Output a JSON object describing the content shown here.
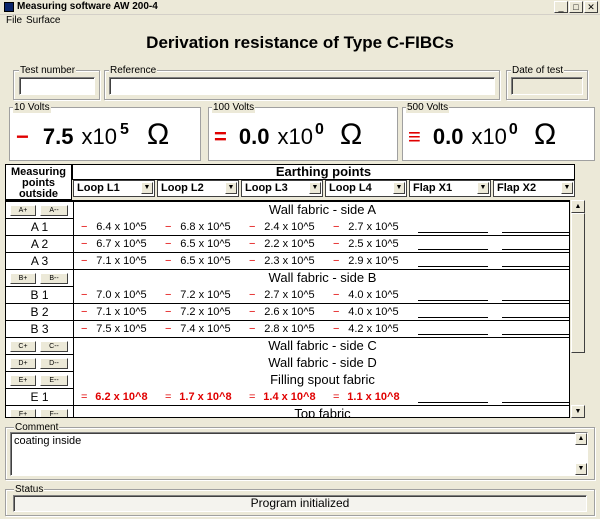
{
  "window": {
    "title": "Measuring software AW 200-4"
  },
  "menu": [
    "File",
    "Surface"
  ],
  "page_title": "Derivation resistance of Type C-FIBCs",
  "fields": {
    "test_number": {
      "label": "Test number",
      "value": ""
    },
    "reference": {
      "label": "Reference",
      "value": ""
    },
    "date_of_test": {
      "label": "Date of test",
      "value": ""
    }
  },
  "voltages": [
    {
      "label": "10 Volts",
      "sign": "−",
      "mantissa": "7.5",
      "x": "x10",
      "exp": "5",
      "unit": "Ω"
    },
    {
      "label": "100 Volts",
      "sign": "=",
      "mantissa": "0.0",
      "x": "x10",
      "exp": "0",
      "unit": "Ω"
    },
    {
      "label": "500 Volts",
      "sign": "≡",
      "mantissa": "0.0",
      "x": "x10",
      "exp": "0",
      "unit": "Ω"
    }
  ],
  "grid": {
    "measuring_header": "Measuring points outside",
    "earthing_header": "Earthing points",
    "columns": [
      "Loop L1",
      "Loop L2",
      "Loop L3",
      "Loop L4",
      "Flap X1",
      "Flap X2"
    ],
    "sections": [
      {
        "title": "Wall fabric - side A",
        "btn_plus": "A+",
        "btn_minus": "A--",
        "rows": [
          {
            "label": "A 1",
            "sign": "−",
            "values": [
              "6.4 x 10^5",
              "6.8 x 10^5",
              "2.4 x 10^5",
              "2.7 x 10^5"
            ]
          },
          {
            "label": "A 2",
            "sign": "−",
            "values": [
              "6.7 x 10^5",
              "6.5 x 10^5",
              "2.2 x 10^5",
              "2.5 x 10^5"
            ]
          },
          {
            "label": "A 3",
            "sign": "−",
            "values": [
              "7.1 x 10^5",
              "6.5 x 10^5",
              "2.3 x 10^5",
              "2.9 x 10^5"
            ]
          }
        ]
      },
      {
        "title": "Wall fabric - side B",
        "btn_plus": "B+",
        "btn_minus": "B--",
        "rows": [
          {
            "label": "B 1",
            "sign": "−",
            "values": [
              "7.0 x 10^5",
              "7.2 x 10^5",
              "2.7 x 10^5",
              "4.0 x 10^5"
            ]
          },
          {
            "label": "B 2",
            "sign": "−",
            "values": [
              "7.1 x 10^5",
              "7.2 x 10^5",
              "2.6 x 10^5",
              "4.0 x 10^5"
            ]
          },
          {
            "label": "B 3",
            "sign": "−",
            "values": [
              "7.5 x 10^5",
              "7.4 x 10^5",
              "2.8 x 10^5",
              "4.2 x 10^5"
            ]
          }
        ]
      },
      {
        "title": "Wall fabric - side C",
        "btn_plus": "C+",
        "btn_minus": "C--",
        "rows": []
      },
      {
        "title": "Wall fabric - side D",
        "btn_plus": "D+",
        "btn_minus": "D--",
        "rows": []
      },
      {
        "title": "Filling spout fabric",
        "btn_plus": "E+",
        "btn_minus": "E--",
        "rows": [
          {
            "label": "E 1",
            "sign": "=",
            "red": true,
            "values": [
              "6.2 x 10^8",
              "1.7 x 10^8",
              "1.4 x 10^8",
              "1.1 x 10^8"
            ]
          }
        ]
      },
      {
        "title": "Top fabric",
        "btn_plus": "F+",
        "btn_minus": "F--",
        "rows": []
      }
    ]
  },
  "comment": {
    "label": "Comment",
    "value": "coating inside"
  },
  "status": {
    "label": "Status",
    "value": "Program initialized"
  }
}
